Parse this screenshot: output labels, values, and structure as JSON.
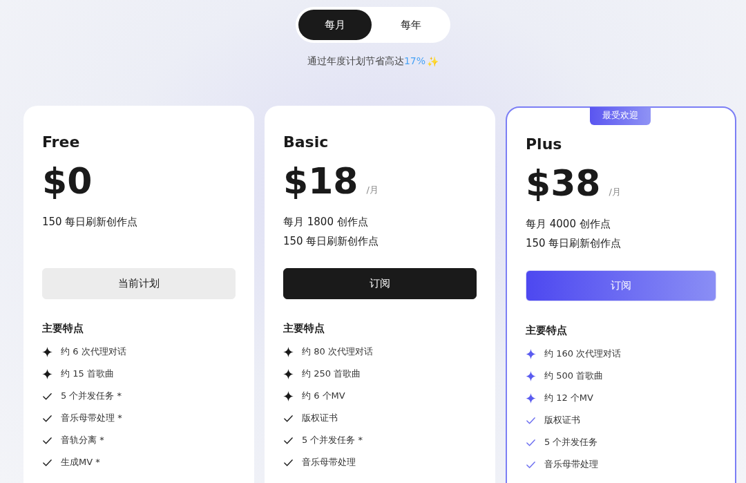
{
  "billing_toggle": [
    {
      "label": "每月",
      "selected": true
    },
    {
      "label": "每年",
      "selected": false
    }
  ],
  "savings_note": {
    "text": "通过年度计划节省高达",
    "highlight": "17%",
    "emoji": "✨"
  },
  "plans": [
    {
      "name": "Free",
      "price": "$0",
      "highlighted": false,
      "credits": [
        "150 每日刷新创作点"
      ],
      "button": {
        "label": "当前计划",
        "kind": "current"
      },
      "features_title": "主要特点",
      "features": [
        {
          "kind": "sparkle",
          "text": "约 6 次代理对话"
        },
        {
          "kind": "sparkle",
          "text": "约 15 首歌曲"
        },
        {
          "kind": "check",
          "text": "5 个并发任务 *"
        },
        {
          "kind": "check",
          "text": "音乐母带处理 *"
        },
        {
          "kind": "check",
          "text": "音轨分离 *"
        },
        {
          "kind": "check",
          "text": "生成MV *"
        }
      ]
    },
    {
      "name": "Basic",
      "price": "$18",
      "period": "/月",
      "highlighted": false,
      "credits": [
        "每月 1800 创作点",
        "150 每日刷新创作点"
      ],
      "button": {
        "label": "订阅",
        "kind": "dark"
      },
      "features_title": "主要特点",
      "features": [
        {
          "kind": "sparkle",
          "text": "约 80 次代理对话"
        },
        {
          "kind": "sparkle",
          "text": "约 250 首歌曲"
        },
        {
          "kind": "sparkle",
          "text": "约 6 个MV"
        },
        {
          "kind": "check",
          "text": "版权证书"
        },
        {
          "kind": "check",
          "text": "5 个并发任务 *"
        },
        {
          "kind": "check",
          "text": "音乐母带处理"
        }
      ]
    },
    {
      "name": "Plus",
      "price": "$38",
      "period": "/月",
      "highlighted": true,
      "badge": "最受欢迎",
      "credits": [
        "每月 4000 创作点",
        "150 每日刷新创作点"
      ],
      "button": {
        "label": "订阅",
        "kind": "gradient"
      },
      "features_title": "主要特点",
      "features": [
        {
          "kind": "sparkle",
          "text": "约 160 次代理对话"
        },
        {
          "kind": "sparkle",
          "text": "约 500 首歌曲"
        },
        {
          "kind": "sparkle",
          "text": "约 12 个MV"
        },
        {
          "kind": "check",
          "text": "版权证书"
        },
        {
          "kind": "check",
          "text": "5 个并发任务"
        },
        {
          "kind": "check",
          "text": "音乐母带处理"
        }
      ]
    }
  ]
}
